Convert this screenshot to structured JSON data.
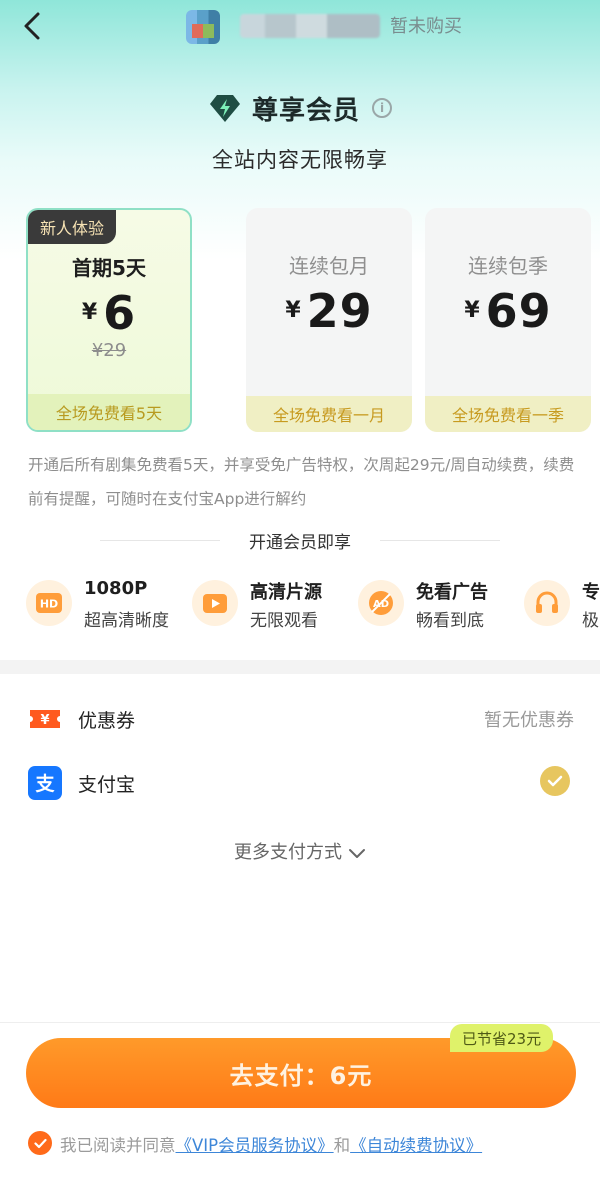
{
  "header": {
    "status_text": "暂未购买"
  },
  "title": {
    "text": "尊享会员",
    "info_mark": "i"
  },
  "subtitle": "全站内容无限畅享",
  "plans": [
    {
      "badge": "新人体验",
      "name": "首期5天",
      "currency": "¥",
      "price": "6",
      "original_price": "¥29",
      "footer": "全场免费看5天"
    },
    {
      "name": "连续包月",
      "currency": "¥",
      "price": "29",
      "footer": "全场免费看一月"
    },
    {
      "name": "连续包季",
      "currency": "¥",
      "price": "69",
      "footer": "全场免费看一季"
    }
  ],
  "terms_text": "开通后所有剧集免费看5天，并享受免广告特权，次周起29元/周自动续费，续费前有提醒，可随时在支付宝App进行解约",
  "benefits": {
    "header": "开通会员即享",
    "items": [
      {
        "title": "1080P",
        "desc": "超高清晰度",
        "icon_text": "HD"
      },
      {
        "title": "高清片源",
        "desc": "无限观看"
      },
      {
        "title": "免看广告",
        "desc": "畅看到底",
        "icon_text": "AD"
      },
      {
        "title": "专",
        "desc": "极"
      }
    ]
  },
  "payment": {
    "coupon_label": "优惠券",
    "coupon_icon_text": "¥",
    "coupon_value": "暂无优惠券",
    "alipay_label": "支付宝",
    "alipay_icon_text": "支",
    "more_methods": "更多支付方式"
  },
  "checkout": {
    "button_label": "去支付：6元",
    "save_badge": "已节省23元"
  },
  "agreement": {
    "prefix": "我已阅读并同意",
    "link_vip": "《VIP会员服务协议》",
    "conjunction": "和",
    "link_auto": "《自动续费协议》"
  },
  "colors": {
    "accent_orange": "#ff7a17",
    "selected_border": "#8fe0c6",
    "link_blue": "#3d86d8",
    "gold": "#e7c65f"
  }
}
